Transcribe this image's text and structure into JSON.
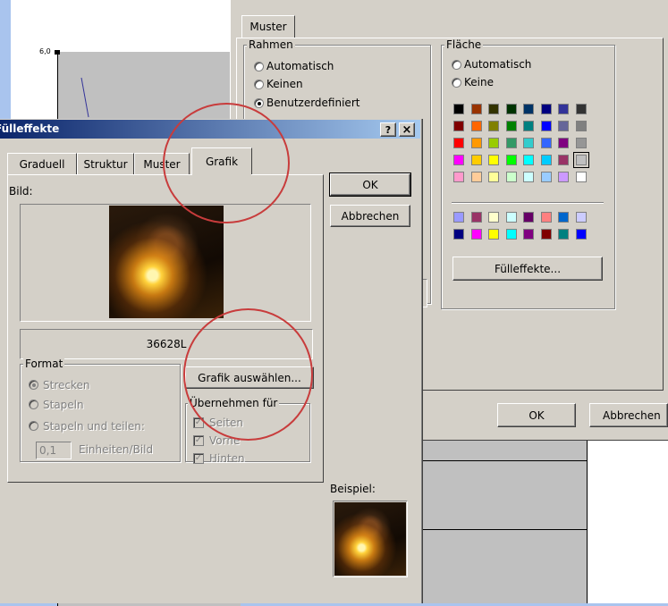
{
  "background_chart": {
    "axis_value": "6,0"
  },
  "format_dialog": {
    "tab": "Muster",
    "rahmen": {
      "label": "Rahmen",
      "options": [
        "Automatisch",
        "Keinen",
        "Benutzerdefiniert"
      ]
    },
    "flaeche": {
      "label": "Fläche",
      "options": [
        "Automatisch",
        "Keine"
      ],
      "palette_rows": [
        [
          "#000000",
          "#993300",
          "#333300",
          "#003300",
          "#003366",
          "#000080",
          "#333399",
          "#333333"
        ],
        [
          "#800000",
          "#ff6600",
          "#808000",
          "#008000",
          "#008080",
          "#0000ff",
          "#666699",
          "#808080"
        ],
        [
          "#ff0000",
          "#ff9900",
          "#99cc00",
          "#339966",
          "#33cccc",
          "#3366ff",
          "#800080",
          "#969696"
        ],
        [
          "#ff00ff",
          "#ffcc00",
          "#ffff00",
          "#00ff00",
          "#00ffff",
          "#00ccff",
          "#993366",
          "#c0c0c0"
        ],
        [
          "#ff99cc",
          "#ffcc99",
          "#ffff99",
          "#ccffcc",
          "#ccffff",
          "#99ccff",
          "#cc99ff",
          "#ffffff"
        ]
      ],
      "chart_rows": [
        [
          "#9999ff",
          "#993366",
          "#ffffcc",
          "#ccffff",
          "#660066",
          "#ff8080",
          "#0066cc",
          "#ccccff"
        ],
        [
          "#000080",
          "#ff00ff",
          "#ffff00",
          "#00ffff",
          "#800080",
          "#800000",
          "#008080",
          "#0000ff"
        ]
      ],
      "fill_effects_button": "Fülleffekte..."
    },
    "ok_button": "OK",
    "cancel_button": "Abbrechen"
  },
  "fill_dialog": {
    "title": "Fülleffekte",
    "help_button": "?",
    "close_button": "×",
    "tabs": [
      "Graduell",
      "Struktur",
      "Muster",
      "Grafik"
    ],
    "active_tab": "Grafik",
    "image_label": "Bild:",
    "image_name": "36628L",
    "select_image_button": "Grafik auswählen...",
    "format": {
      "label": "Format",
      "options": [
        "Strecken",
        "Stapeln",
        "Stapeln und teilen:"
      ],
      "units_value": "0,1",
      "units_label": "Einheiten/Bild"
    },
    "apply_for": {
      "label": "Übernehmen für",
      "options": [
        "Seiten",
        "Vorne",
        "Hinten"
      ]
    },
    "ok_button": "OK",
    "cancel_button": "Abbrechen",
    "sample_label": "Beispiel:"
  }
}
